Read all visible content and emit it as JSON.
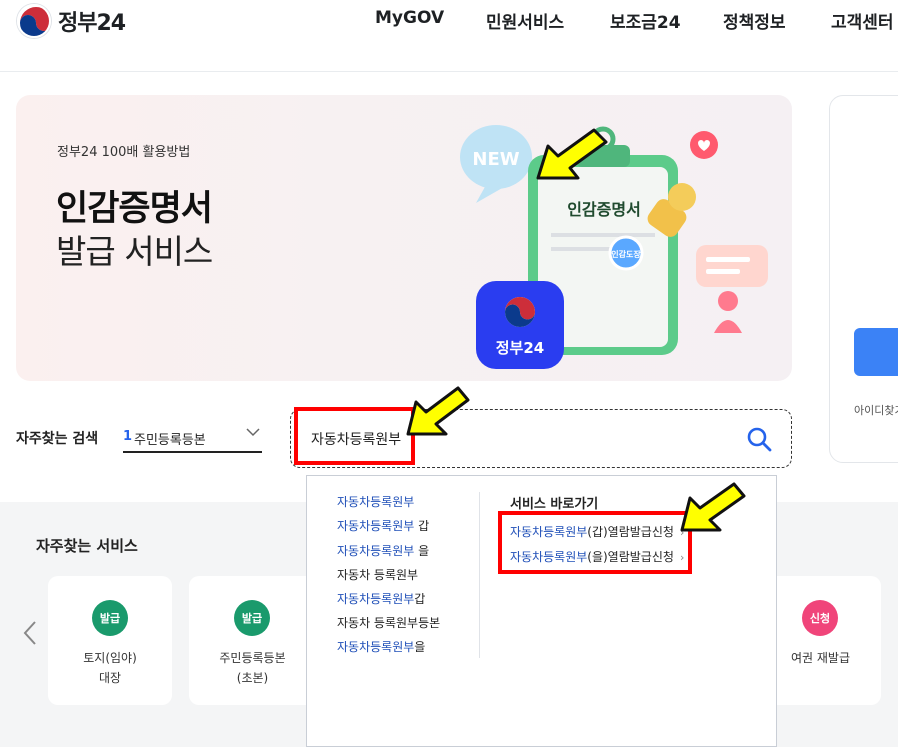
{
  "header": {
    "logo_text": "정부24",
    "nav": [
      "MyGOV",
      "민원서비스",
      "보조금24",
      "정책정보",
      "고객센터"
    ]
  },
  "hero": {
    "kicker": "정부24 100배 활용방법",
    "title": "인감증명서",
    "subtitle": "발급 서비스",
    "badge_new": "NEW",
    "doc_title": "인감증명서",
    "stamp_text": "인감도장",
    "app_label": "정부24"
  },
  "side": {
    "help_text": "아이디찾기"
  },
  "popular_search": {
    "label": "자주찾는 검색",
    "rank": "1",
    "term": "주민등록등본"
  },
  "search": {
    "value": "자동차등록원부"
  },
  "suggestions": [
    {
      "hl": "자동차등록원부",
      "tail": ""
    },
    {
      "hl": "자동차등록원부",
      "tail": " 갑"
    },
    {
      "hl": "자동차등록원부",
      "tail": " 을"
    },
    {
      "hl": "",
      "tail": "자동차 등록원부"
    },
    {
      "hl": "자동차등록원부",
      "tail": "갑"
    },
    {
      "hl": "",
      "tail": "자동차 등록원부등본"
    },
    {
      "hl": "자동차등록원부",
      "tail": "을"
    }
  ],
  "shortcuts": {
    "title": "서비스 바로가기",
    "items": [
      {
        "hl": "자동차등록원부",
        "tail": "(갑)열람발급신청"
      },
      {
        "hl": "자동차등록원부",
        "tail": "(을)열람발급신청"
      }
    ]
  },
  "frequent_services": {
    "title": "자주찾는 서비스",
    "cards": [
      {
        "badge": "발급",
        "name": "토지(임야)\n대장",
        "color": "#1a9a6c"
      },
      {
        "badge": "발급",
        "name": "주민등록등본\n(초본)",
        "color": "#1a9a6c"
      },
      {
        "badge": "신청",
        "name": "여권 재발급",
        "color": "#f0457a"
      }
    ]
  },
  "colors": {
    "accent_blue": "#2563eb",
    "highlight_red": "#ff0000",
    "pointer_yellow": "#ffff00"
  }
}
